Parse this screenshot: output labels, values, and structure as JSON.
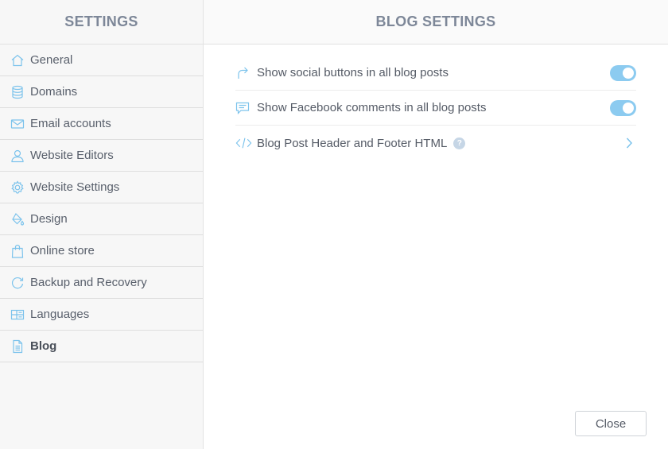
{
  "sidebar": {
    "title": "SETTINGS",
    "items": [
      {
        "label": "General",
        "icon": "home-icon"
      },
      {
        "label": "Domains",
        "icon": "database-icon"
      },
      {
        "label": "Email accounts",
        "icon": "envelope-icon"
      },
      {
        "label": "Website Editors",
        "icon": "user-icon"
      },
      {
        "label": "Website Settings",
        "icon": "gear-icon"
      },
      {
        "label": "Design",
        "icon": "paint-bucket-icon"
      },
      {
        "label": "Online store",
        "icon": "shopping-bag-icon"
      },
      {
        "label": "Backup and Recovery",
        "icon": "refresh-icon"
      },
      {
        "label": "Languages",
        "icon": "language-grid-icon"
      },
      {
        "label": "Blog",
        "icon": "document-icon",
        "active": true
      }
    ]
  },
  "main": {
    "title": "BLOG SETTINGS",
    "rows": [
      {
        "label": "Show social buttons in all blog posts",
        "icon": "share-arrow-icon",
        "toggle_on": true
      },
      {
        "label": "Show Facebook comments in all blog posts",
        "icon": "comment-icon",
        "toggle_on": true
      },
      {
        "label": "Blog Post Header and Footer HTML",
        "icon": "code-icon",
        "help": "?"
      }
    ]
  },
  "footer": {
    "close_label": "Close"
  },
  "colors": {
    "accent": "#8ccbf0",
    "icon": "#7cc3ec",
    "title": "#7d8798"
  }
}
